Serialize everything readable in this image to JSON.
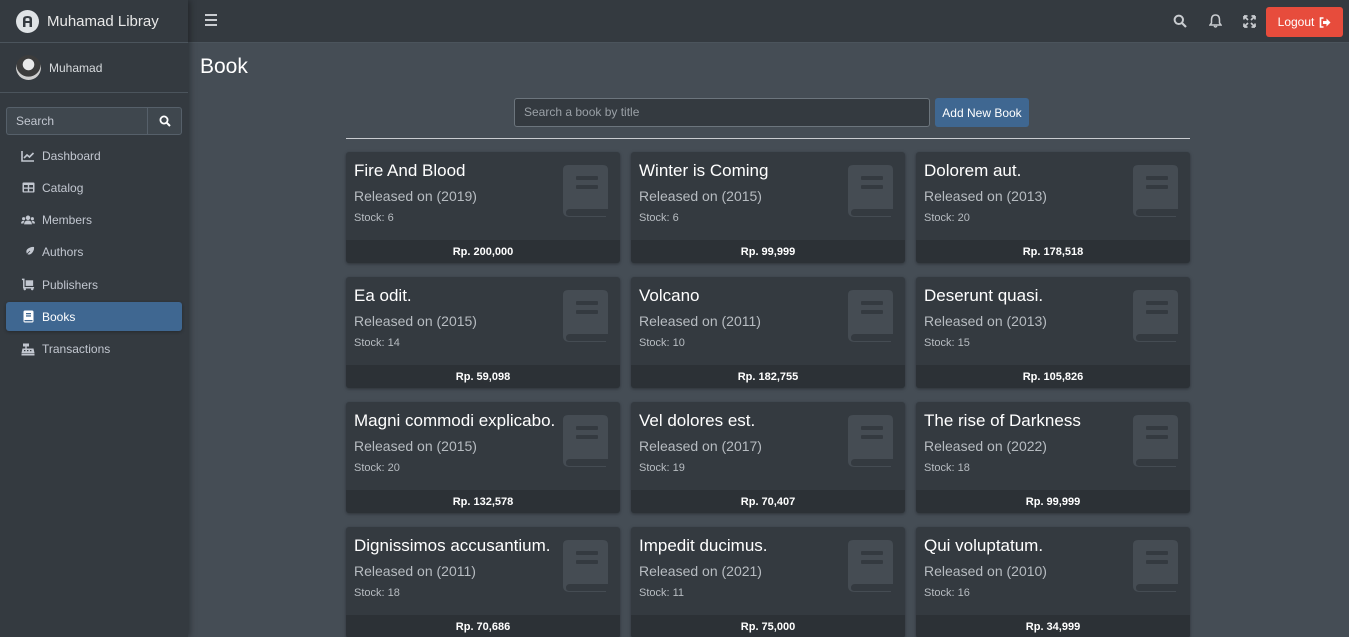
{
  "app": {
    "brand": "Muhamad Libray",
    "user_name": "Muhamad"
  },
  "sidebar": {
    "search_placeholder": "Search",
    "items": [
      {
        "label": "Dashboard",
        "icon": "chart-line-icon"
      },
      {
        "label": "Catalog",
        "icon": "table-icon"
      },
      {
        "label": "Members",
        "icon": "users-icon"
      },
      {
        "label": "Authors",
        "icon": "feather-icon"
      },
      {
        "label": "Publishers",
        "icon": "dolly-icon"
      },
      {
        "label": "Books",
        "icon": "book-icon",
        "active": true
      },
      {
        "label": "Transactions",
        "icon": "cash-register-icon"
      }
    ]
  },
  "topbar": {
    "logout_label": "Logout"
  },
  "main": {
    "title": "Book",
    "search_placeholder": "Search a book by title",
    "add_button": "Add New Book"
  },
  "books": [
    {
      "title": "Fire And Blood",
      "release": "Released on (2019)",
      "stock": "Stock: 6",
      "price": "Rp. 200,000"
    },
    {
      "title": "Winter is Coming",
      "release": "Released on (2015)",
      "stock": "Stock: 6",
      "price": "Rp. 99,999"
    },
    {
      "title": "Dolorem aut.",
      "release": "Released on (2013)",
      "stock": "Stock: 20",
      "price": "Rp. 178,518"
    },
    {
      "title": "Ea odit.",
      "release": "Released on (2015)",
      "stock": "Stock: 14",
      "price": "Rp. 59,098"
    },
    {
      "title": "Volcano",
      "release": "Released on (2011)",
      "stock": "Stock: 10",
      "price": "Rp. 182,755"
    },
    {
      "title": "Deserunt quasi.",
      "release": "Released on (2013)",
      "stock": "Stock: 15",
      "price": "Rp. 105,826"
    },
    {
      "title": "Magni commodi explicabo.",
      "release": "Released on (2015)",
      "stock": "Stock: 20",
      "price": "Rp. 132,578"
    },
    {
      "title": "Vel dolores est.",
      "release": "Released on (2017)",
      "stock": "Stock: 19",
      "price": "Rp. 70,407"
    },
    {
      "title": "The rise of Darkness",
      "release": "Released on (2022)",
      "stock": "Stock: 18",
      "price": "Rp. 99,999"
    },
    {
      "title": "Dignissimos accusantium.",
      "release": "Released on (2011)",
      "stock": "Stock: 18",
      "price": "Rp. 70,686"
    },
    {
      "title": "Impedit ducimus.",
      "release": "Released on (2021)",
      "stock": "Stock: 11",
      "price": "Rp. 75,000"
    },
    {
      "title": "Qui voluptatum.",
      "release": "Released on (2010)",
      "stock": "Stock: 16",
      "price": "Rp. 34,999"
    }
  ],
  "colors": {
    "accent": "#3f6791",
    "logout": "#e74c3c",
    "sidebar": "#343a40",
    "content": "#454d55"
  }
}
